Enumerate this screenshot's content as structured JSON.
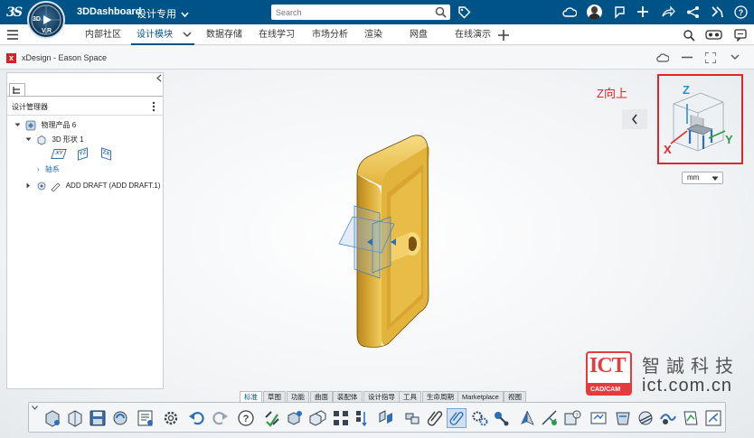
{
  "topbar": {
    "compass_labels": [
      "3D",
      "V,R"
    ],
    "app_title": "3DDashboard",
    "dashboard_name": "设计专用",
    "search_placeholder": "Search"
  },
  "tabs": [
    {
      "label": "内部社区",
      "active": false
    },
    {
      "label": "设计模块",
      "active": true
    },
    {
      "label": "数据存储",
      "active": false
    },
    {
      "label": "在线学习",
      "active": false
    },
    {
      "label": "市场分析",
      "active": false
    },
    {
      "label": "渲染",
      "active": false
    },
    {
      "label": "网盘",
      "active": false
    },
    {
      "label": "在线演示",
      "active": false
    }
  ],
  "appbar": {
    "title": "xDesign - Eason Space"
  },
  "panel": {
    "header": "设计管理器",
    "tree": [
      {
        "label": "物理产品 6",
        "level": 0,
        "expanded": true
      },
      {
        "label": "3D 形状 1",
        "level": 1,
        "expanded": true
      },
      {
        "label": "轴系",
        "level": 2,
        "expanded": false
      },
      {
        "label": "ADD DRAFT (ADD DRAFT.1)",
        "level": 1,
        "expanded": false
      }
    ],
    "planes": [
      "XY",
      "YZ",
      "ZX"
    ]
  },
  "viewport": {
    "annotation": "Z向上",
    "units": "mm",
    "axis_labels": {
      "x": "X",
      "y": "Y",
      "z": "Z"
    },
    "axis_colors": {
      "x": "#e0262b",
      "y": "#2e9a46",
      "z": "#2c8ed0"
    },
    "highlight_color": "#e0262b",
    "part_color": "#e3b43c"
  },
  "watermark": {
    "badge": "ICT",
    "badge_sub": "CAD/CAM",
    "company": "智誠科技",
    "domain": "ict.com.cn"
  },
  "toolbar_tabs": [
    {
      "label": "标准",
      "active": true
    },
    {
      "label": "草图",
      "active": false
    },
    {
      "label": "功能",
      "active": false
    },
    {
      "label": "曲面",
      "active": false
    },
    {
      "label": "装配体",
      "active": false
    },
    {
      "label": "设计指导",
      "active": false
    },
    {
      "label": "工具",
      "active": false
    },
    {
      "label": "生命周期",
      "active": false
    },
    {
      "label": "Marketplace",
      "active": false
    },
    {
      "label": "视图",
      "active": false
    }
  ]
}
